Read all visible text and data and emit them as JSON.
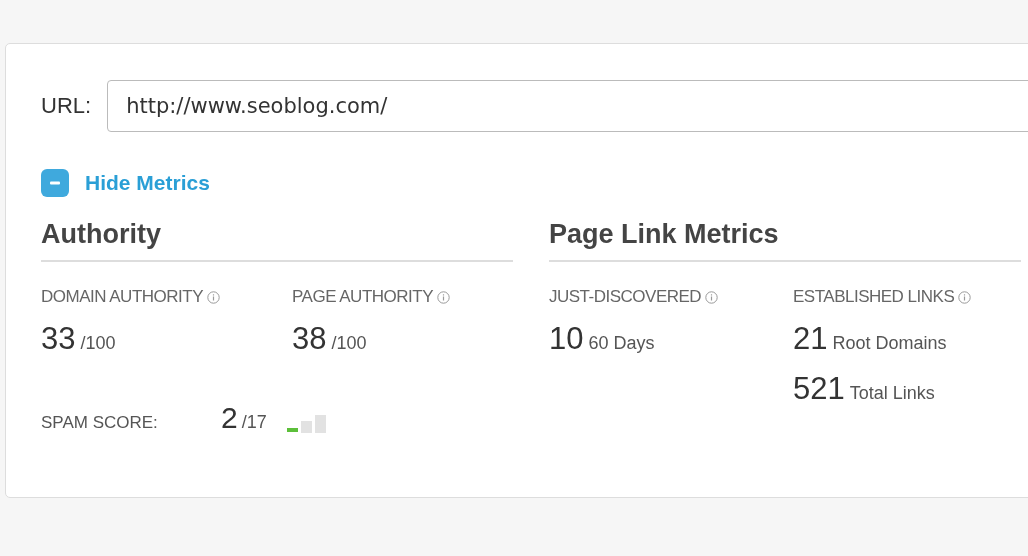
{
  "url_field": {
    "label": "URL:",
    "value": "http://www.seoblog.com/"
  },
  "toggle": {
    "label": "Hide Metrics",
    "expanded": true
  },
  "sections": [
    {
      "title": "Authority",
      "metrics": [
        {
          "label": "DOMAIN AUTHORITY",
          "values": [
            {
              "number": "33",
              "unit": "/100"
            }
          ]
        },
        {
          "label": "PAGE AUTHORITY",
          "values": [
            {
              "number": "38",
              "unit": "/100"
            }
          ]
        }
      ],
      "spam_score": {
        "label": "SPAM SCORE:",
        "number": "2",
        "unit": "/17",
        "level": 0.33
      }
    },
    {
      "title": "Page Link Metrics",
      "metrics": [
        {
          "label": "JUST-DISCOVERED",
          "values": [
            {
              "number": "10",
              "unit": "60 Days"
            }
          ]
        },
        {
          "label": "ESTABLISHED LINKS",
          "values": [
            {
              "number": "21",
              "unit": "Root Domains"
            },
            {
              "number": "521",
              "unit": "Total Links"
            }
          ]
        }
      ]
    }
  ]
}
